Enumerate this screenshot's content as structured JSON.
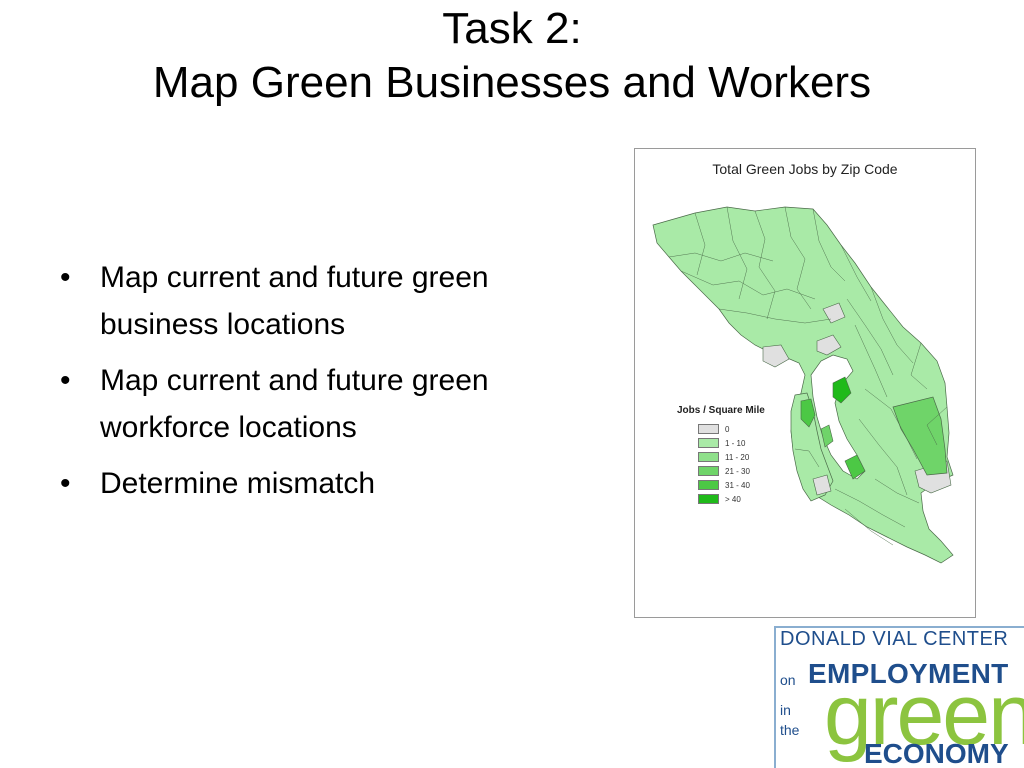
{
  "slide": {
    "title_line1": "Task 2:",
    "title_line2": "Map Green Businesses and Workers"
  },
  "bullets": [
    {
      "symbol": "•",
      "text": "Map current and future green business locations"
    },
    {
      "symbol": "•",
      "text": "Map current and future green workforce locations"
    },
    {
      "symbol": "•",
      "text": "Determine mismatch"
    }
  ],
  "map": {
    "title": "Total Green Jobs by Zip Code",
    "legend_title": "Jobs / Square Mile",
    "legend": [
      {
        "label": "0",
        "color": "#e0e0e0"
      },
      {
        "label": "1 - 10",
        "color": "#a9eaa7"
      },
      {
        "label": "11 - 20",
        "color": "#8fe08b"
      },
      {
        "label": "21 - 30",
        "color": "#6fd469"
      },
      {
        "label": "31 - 40",
        "color": "#4cc845"
      },
      {
        "label": "> 40",
        "color": "#1fba1a"
      }
    ]
  },
  "logo": {
    "line1": "DONALD VIAL CENTER",
    "on": "on",
    "employment": "EMPLOYMENT",
    "in": "in",
    "the": "the",
    "green": "green",
    "economy": "ECONOMY"
  }
}
